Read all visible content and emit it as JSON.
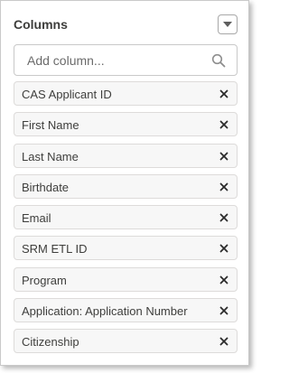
{
  "panel": {
    "title": "Columns",
    "collapse_icon": "caret-down-icon"
  },
  "search": {
    "placeholder": "Add column...",
    "value": "",
    "icon": "search-icon"
  },
  "columns": [
    {
      "label": "CAS Applicant ID"
    },
    {
      "label": "First Name"
    },
    {
      "label": "Last Name"
    },
    {
      "label": "Birthdate"
    },
    {
      "label": "Email"
    },
    {
      "label": "SRM ETL ID"
    },
    {
      "label": "Program"
    },
    {
      "label": "Application: Application Number"
    },
    {
      "label": "Citizenship"
    }
  ],
  "colors": {
    "text": "#3e3e3c",
    "pill_bg": "#f7f7f7",
    "pill_border": "#dddbda",
    "input_border": "#c9c9c9"
  }
}
